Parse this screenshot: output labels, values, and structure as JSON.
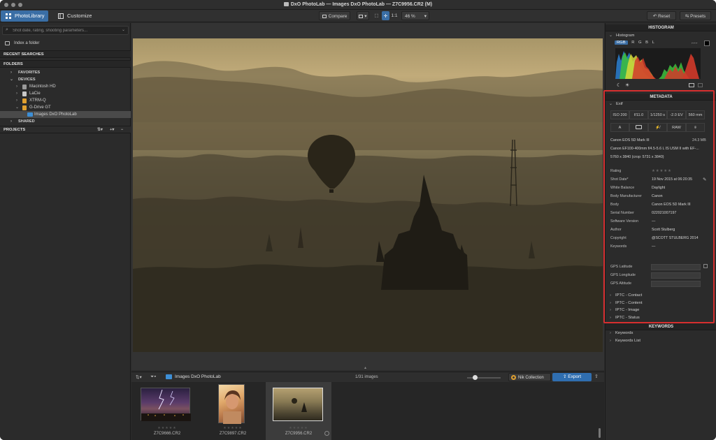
{
  "window": {
    "title": "DxO PhotoLab — Images DxO PhotoLab — Z7C9956.CR2 (M)"
  },
  "toolbar": {
    "tabs": [
      {
        "label": "PhotoLibrary",
        "active": true
      },
      {
        "label": "Customize",
        "active": false
      }
    ],
    "compare_label": "Compare",
    "ratio_label": "1:1",
    "zoom_value": "46 %",
    "reset_label": "Reset",
    "presets_label": "Presets"
  },
  "left_panel": {
    "search_placeholder": "Shot date, rating, shooting parameters...",
    "index_folder_label": "Index a folder",
    "recent_searches_label": "RECENT SEARCHES",
    "folders_label": "FOLDERS",
    "tree": [
      {
        "label": "FAVORITES",
        "level": 0
      },
      {
        "label": "DEVICES",
        "level": 0
      },
      {
        "label": "Macintosh HD",
        "level": 1
      },
      {
        "label": "LaCie",
        "level": 1
      },
      {
        "label": "XTRM-Q",
        "level": 1
      },
      {
        "label": "G-Drive GT",
        "level": 1
      },
      {
        "label": "Images DxO PhotoLab",
        "level": 2,
        "selected": true
      },
      {
        "label": "SHARED",
        "level": 0
      }
    ],
    "projects_label": "PROJECTS"
  },
  "filmstrip": {
    "folder_label": "Images DxO PhotoLab",
    "count_label": "1/31 images",
    "nik_label": "Nik Collection",
    "export_label": "Export",
    "thumbnails": [
      {
        "name": "Z7C9666.CR2",
        "selected": false
      },
      {
        "name": "Z7C9897.CR2",
        "selected": false
      },
      {
        "name": "Z7C9956.CR2",
        "selected": true
      }
    ]
  },
  "right_panel": {
    "histogram_header": "HISTOGRAM",
    "histogram_label": "Histogram",
    "channels": [
      "RGB",
      "R",
      "G",
      "B",
      "L"
    ],
    "metadata_header": "METADATA",
    "exif_label": "Exif",
    "exif_cells": [
      "ISO 200",
      "f/11.0",
      "1/1250 s",
      "-2.0 EV",
      "560 mm"
    ],
    "exif_icons": [
      "A",
      "",
      "",
      "RAW",
      ""
    ],
    "camera_line": "Canon EOS 5D Mark III",
    "file_size": "24.3 MB",
    "lens_line": "Canon EF100-400mm f/4.5-5.6 L IS USM II with EF-...",
    "dimensions_line": "5760 x 3840 (crop: 5731 x 3840)",
    "fields": [
      {
        "label": "Rating",
        "value": "★★★★★"
      },
      {
        "label": "Shot Date*",
        "value": "19 Nov 2015 at 06:20:35"
      },
      {
        "label": "White Balance",
        "value": "Daylight"
      },
      {
        "label": "Body Manufacturer",
        "value": "Canon"
      },
      {
        "label": "Body",
        "value": "Canon EOS 5D Mark III"
      },
      {
        "label": "Serial Number",
        "value": "022021007197"
      },
      {
        "label": "Software Version",
        "value": "—"
      },
      {
        "label": "Author",
        "value": "Scott Stulberg"
      },
      {
        "label": "Copyright",
        "value": "@SCOTT STULBERG 2014"
      },
      {
        "label": "Keywords",
        "value": "—"
      }
    ],
    "gps_fields": [
      "GPS Latitude",
      "GPS Longitude",
      "GPS Altitude"
    ],
    "iptc_sections": [
      "IPTC - Contact",
      "IPTC - Content",
      "IPTC - Image",
      "IPTC - Status"
    ],
    "keywords_header": "KEYWORDS",
    "keywords_rows": [
      "Keywords",
      "Keywords List"
    ]
  },
  "colors": {
    "accent": "#3a6ea5",
    "highlight_border": "#d62f2f"
  }
}
